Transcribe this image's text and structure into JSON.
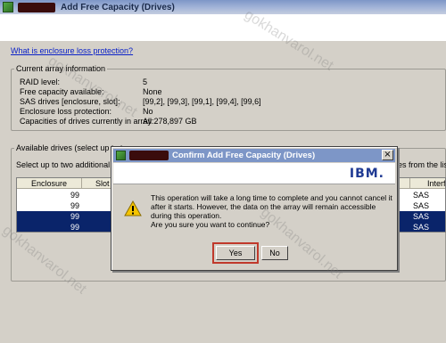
{
  "window": {
    "title": "Add Free Capacity (Drives)"
  },
  "help_link": "What is enclosure loss protection?",
  "current_array": {
    "legend": "Current array information",
    "rows": [
      {
        "label": "RAID level:",
        "value": "5"
      },
      {
        "label": "Free capacity available:",
        "value": "None"
      },
      {
        "label": "SAS drives [enclosure, slot]:",
        "value": "[99,2], [99,3], [99,1], [99,4], [99,6]"
      },
      {
        "label": "Enclosure loss protection:",
        "value": "No"
      },
      {
        "label": "Capacities of drives currently in array:",
        "value": "All 278,897 GB"
      }
    ]
  },
  "available_drives": {
    "legend": "Available drives (select up to t",
    "instruction_left": "Select up to two additional dr",
    "instruction_right": "es from the list",
    "columns": [
      "Enclosure",
      "Slot",
      "Interf"
    ],
    "rows": [
      {
        "enclosure": "99",
        "interface": "SAS",
        "selected": false
      },
      {
        "enclosure": "99",
        "interface": "SAS",
        "selected": false
      },
      {
        "enclosure": "99",
        "interface": "SAS",
        "selected": true
      },
      {
        "enclosure": "99",
        "interface": "SAS",
        "selected": true
      }
    ]
  },
  "dialog": {
    "title": "Confirm Add Free Capacity (Drives)",
    "logo": "IBM.",
    "close": "×",
    "message_lines": [
      "This operation will take a long time to complete and you cannot cancel it",
      "after it starts. However, the data on the array will remain accessible",
      "during this operation."
    ],
    "question": "Are you sure you want to continue?",
    "yes_label": "Yes",
    "no_label": "No"
  },
  "watermark": "gokhanvarol.net",
  "colors": {
    "selection": "#0a246a",
    "highlight_box": "#c0392b",
    "link": "#0a21c8"
  }
}
